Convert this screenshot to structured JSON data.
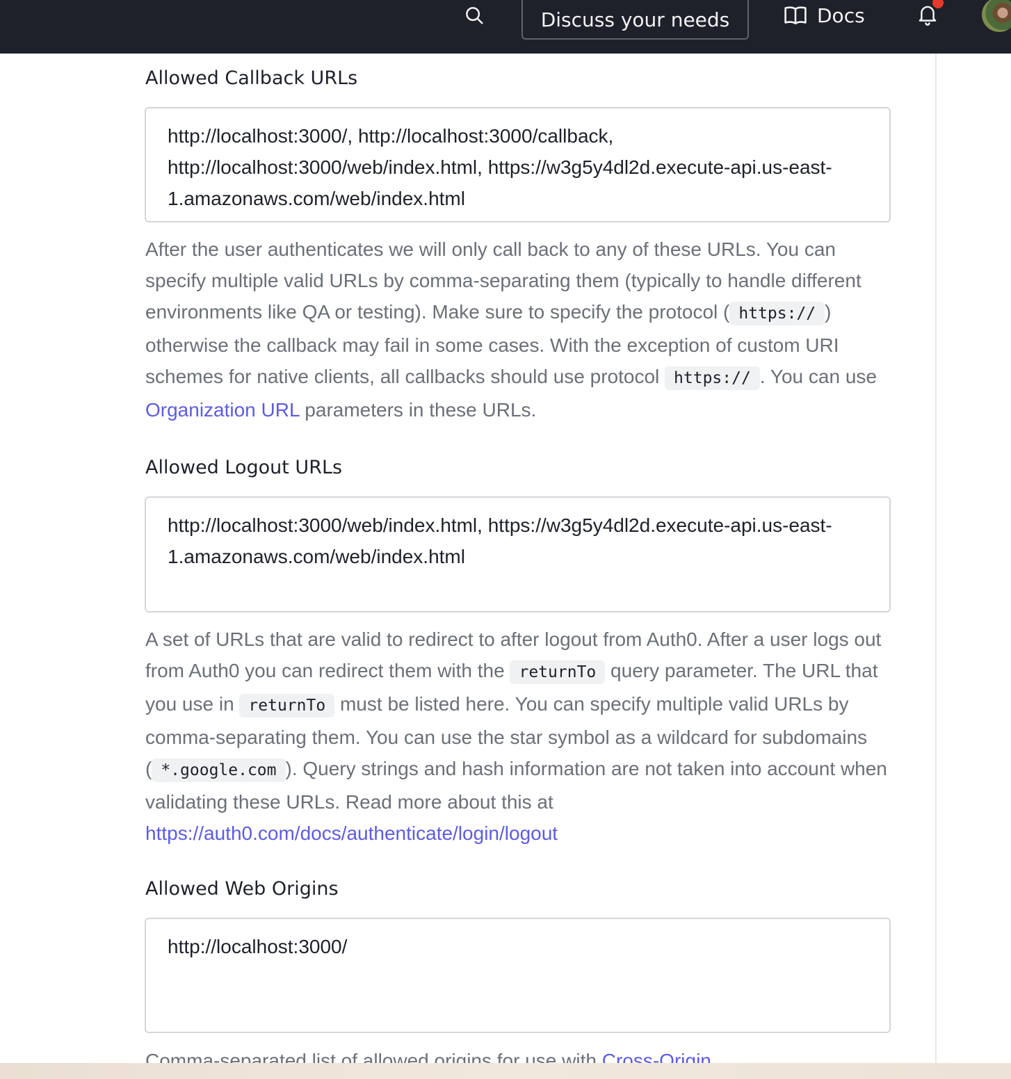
{
  "header": {
    "search_icon": "search-icon",
    "discuss_label": "Discuss your needs",
    "docs_icon": "book-open-icon",
    "docs_label": "Docs",
    "bell_icon": "bell-icon",
    "notification_color": "#e5392c",
    "background": "#1e212a"
  },
  "callback": {
    "label": "Allowed Callback URLs",
    "value": "http://localhost:3000/, http://localhost:3000/callback, http://localhost:3000/web/index.html, https://w3g5y4dl2d.execute-api.us-east-1.amazonaws.com/web/index.html",
    "help": {
      "t1": "After the user authenticates we will only call back to any of these URLs. You can specify multiple valid URLs by comma-separating them (typically to handle different environments like QA or testing). Make sure to specify the protocol (",
      "code1": "https://",
      "t2": ") otherwise the callback may fail in some cases. With the exception of custom URI schemes for native clients, all callbacks should use protocol ",
      "code2": "https://",
      "t3": ". You can use ",
      "link": "Organization URL",
      "t4": " parameters in these URLs."
    }
  },
  "logout": {
    "label": "Allowed Logout URLs",
    "value": "http://localhost:3000/web/index.html, https://w3g5y4dl2d.execute-api.us-east-1.amazonaws.com/web/index.html",
    "help": {
      "t1": "A set of URLs that are valid to redirect to after logout from Auth0. After a user logs out from Auth0 you can redirect them with the ",
      "code1": "returnTo",
      "t2": " query parameter. The URL that you use in ",
      "code2": "returnTo",
      "t3": " must be listed here. You can specify multiple valid URLs by comma-separating them. You can use the star symbol as a wildcard for subdomains (",
      "code3": "*.google.com",
      "t4": "). Query strings and hash information are not taken into account when validating these URLs. Read more about this at ",
      "link": "https://auth0.com/docs/authenticate/login/logout"
    }
  },
  "web_origins": {
    "label": "Allowed Web Origins",
    "value": "http://localhost:3000/",
    "help": {
      "t1": "Comma-separated list of allowed origins for use with ",
      "link": "Cross-Origin"
    }
  },
  "colors": {
    "link": "#5d5ce0",
    "help_text": "#6b6f77",
    "field_border": "#d4d6db"
  }
}
